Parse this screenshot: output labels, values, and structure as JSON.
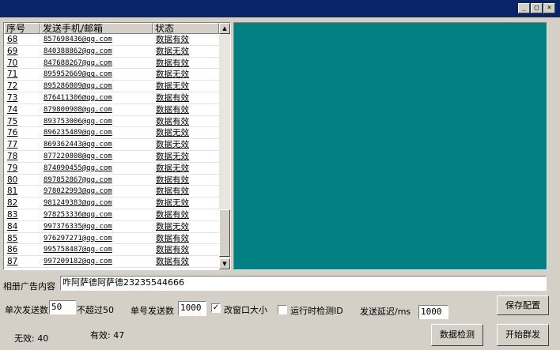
{
  "window": {
    "minimize": "_",
    "maximize": "□",
    "close": "×"
  },
  "list": {
    "headers": {
      "index": "序号",
      "contact": "发送手机/邮箱",
      "status": "状态"
    },
    "rows": [
      {
        "index": "68",
        "contact": "857698436@qq.com",
        "status": "数据有效"
      },
      {
        "index": "69",
        "contact": "840388862@qq.com",
        "status": "数据无效"
      },
      {
        "index": "70",
        "contact": "847688267@qq.com",
        "status": "数据有效"
      },
      {
        "index": "71",
        "contact": "895952669@qq.com",
        "status": "数据无效"
      },
      {
        "index": "72",
        "contact": "895286809@qq.com",
        "status": "数据无效"
      },
      {
        "index": "73",
        "contact": "876411306@qq.com",
        "status": "数据有效"
      },
      {
        "index": "74",
        "contact": "879800908@qq.com",
        "status": "数据有效"
      },
      {
        "index": "75",
        "contact": "893753006@qq.com",
        "status": "数据有效"
      },
      {
        "index": "76",
        "contact": "896235489@qq.com",
        "status": "数据无效"
      },
      {
        "index": "77",
        "contact": "869362443@qq.com",
        "status": "数据无效"
      },
      {
        "index": "78",
        "contact": "877220808@qq.com",
        "status": "数据无效"
      },
      {
        "index": "79",
        "contact": "874090455@qq.com",
        "status": "数据无效"
      },
      {
        "index": "80",
        "contact": "897852867@qq.com",
        "status": "数据有效"
      },
      {
        "index": "81",
        "contact": "978022993@qq.com",
        "status": "数据有效"
      },
      {
        "index": "82",
        "contact": "981249383@qq.com",
        "status": "数据无效"
      },
      {
        "index": "83",
        "contact": "978253336@qq.com",
        "status": "数据有效"
      },
      {
        "index": "84",
        "contact": "997376335@qq.com",
        "status": "数据无效"
      },
      {
        "index": "85",
        "contact": "976297271@qq.com",
        "status": "数据有效"
      },
      {
        "index": "86",
        "contact": "995758487@qq.com",
        "status": "数据有效"
      },
      {
        "index": "87",
        "contact": "997209182@qq.com",
        "status": "数据有效"
      }
    ]
  },
  "form": {
    "ad_label": "相册广告内容",
    "ad_value": "咋阿萨德阿萨德23235544666",
    "batch_label": "单次发送数",
    "batch_value": "50",
    "batch_hint": "不超过50",
    "single_label": "单号发送数",
    "single_value": "1000",
    "resize_label": "改窗口大小",
    "resize_checked": true,
    "detect_label": "运行时检测ID",
    "detect_checked": false,
    "delay_label": "发送延迟/ms",
    "delay_value": "1000",
    "invalid_label": "无效: 40",
    "valid_label": "有效: 47"
  },
  "buttons": {
    "save": "保存配置",
    "check": "数据检测",
    "start": "开始群发"
  },
  "colors": {
    "titlebar": "#0a246a",
    "panel": "#008080",
    "face": "#d4d0c8"
  }
}
